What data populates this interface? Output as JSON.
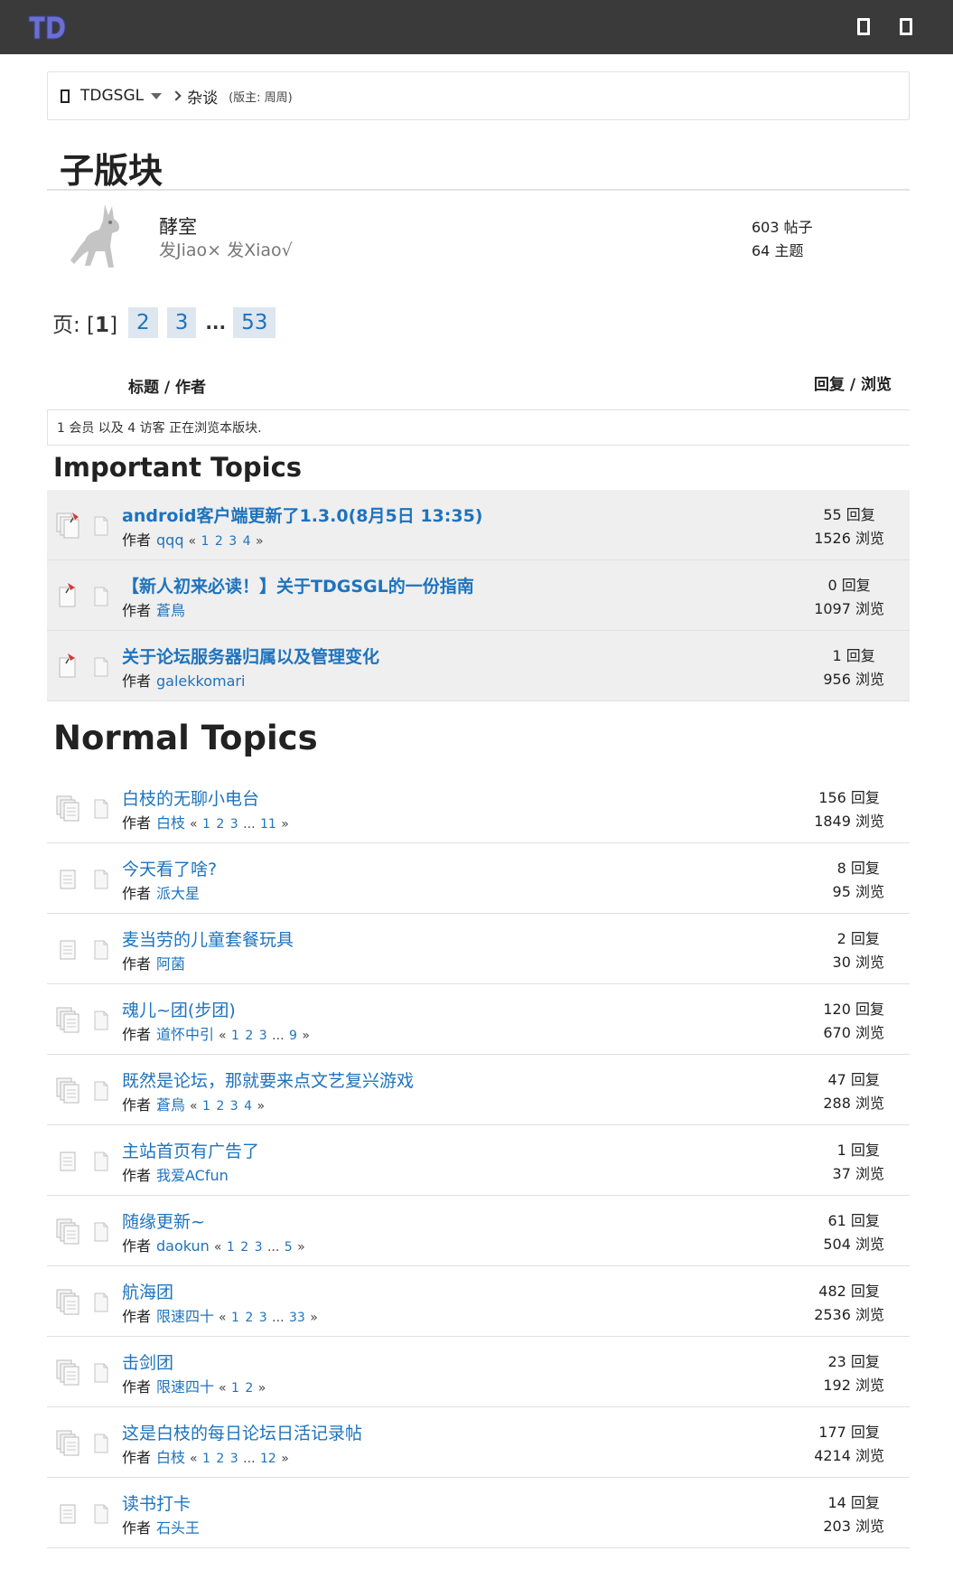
{
  "header": {
    "logo_text": "TD"
  },
  "breadcrumb": {
    "forum": "TDGSGL",
    "board": "杂谈",
    "moderators": "(版主: 周周)"
  },
  "subboards": {
    "heading": "子版块",
    "items": [
      {
        "name": "酵室",
        "description": "发Jiao× 发Xiao√",
        "posts": "603 帖子",
        "topics": "64 主题"
      }
    ]
  },
  "pagination": {
    "prefix": "页: [",
    "current": "1",
    "suffix": "]",
    "pages": [
      "2",
      "3"
    ],
    "ellipsis": "...",
    "last": "53"
  },
  "columns": {
    "title": "标题 / 作者",
    "stats": "回复 / 浏览"
  },
  "viewers": "1 会员 以及 4 访客 正在浏览本版块.",
  "by_label": "作者",
  "important": {
    "heading": "Important Topics",
    "topics": [
      {
        "title": "android客户端更新了1.3.0(8月5日 13:35)",
        "author": "qqq",
        "pages": "« 1 2 3 4 »",
        "replies": "55 回复",
        "views": "1526 浏览"
      },
      {
        "title": "【新人初来必读！】关于TDGSGL的一份指南",
        "author": "蒼鳥",
        "pages": "",
        "replies": "0 回复",
        "views": "1097 浏览"
      },
      {
        "title": "关于论坛服务器归属以及管理变化",
        "author": "galekkomari",
        "pages": "",
        "replies": "1 回复",
        "views": "956 浏览"
      }
    ]
  },
  "normal": {
    "heading": "Normal Topics",
    "topics": [
      {
        "title": "白枝的无聊小电台",
        "author": "白枝",
        "pages": "« 1 2 3 ... 11 »",
        "replies": "156 回复",
        "views": "1849 浏览"
      },
      {
        "title": "今天看了啥?",
        "author": "派大星",
        "pages": "",
        "replies": "8 回复",
        "views": "95 浏览"
      },
      {
        "title": "麦当劳的儿童套餐玩具",
        "author": "阿菌",
        "pages": "",
        "replies": "2 回复",
        "views": "30 浏览"
      },
      {
        "title": "魂儿~团(步团)",
        "author": "道怀中引",
        "pages": "« 1 2 3 ... 9 »",
        "replies": "120 回复",
        "views": "670 浏览"
      },
      {
        "title": "既然是论坛，那就要来点文艺复兴游戏",
        "author": "蒼鳥",
        "pages": "« 1 2 3 4 »",
        "replies": "47 回复",
        "views": "288 浏览"
      },
      {
        "title": "主站首页有广告了",
        "author": "我爱ACfun",
        "pages": "",
        "replies": "1 回复",
        "views": "37 浏览"
      },
      {
        "title": "随缘更新~",
        "author": "daokun",
        "pages": "« 1 2 3 ... 5 »",
        "replies": "61 回复",
        "views": "504 浏览"
      },
      {
        "title": "航海团",
        "author": "限速四十",
        "pages": "« 1 2 3 ... 33 »",
        "replies": "482 回复",
        "views": "2536 浏览"
      },
      {
        "title": "击剑团",
        "author": "限速四十",
        "pages": "« 1 2 »",
        "replies": "23 回复",
        "views": "192 浏览"
      },
      {
        "title": "这是白枝的每日论坛日活记录帖",
        "author": "白枝",
        "pages": "« 1 2 3 ... 12 »",
        "replies": "177 回复",
        "views": "4214 浏览"
      },
      {
        "title": "读书打卡",
        "author": "石头王",
        "pages": "",
        "replies": "14 回复",
        "views": "203 浏览"
      }
    ]
  }
}
